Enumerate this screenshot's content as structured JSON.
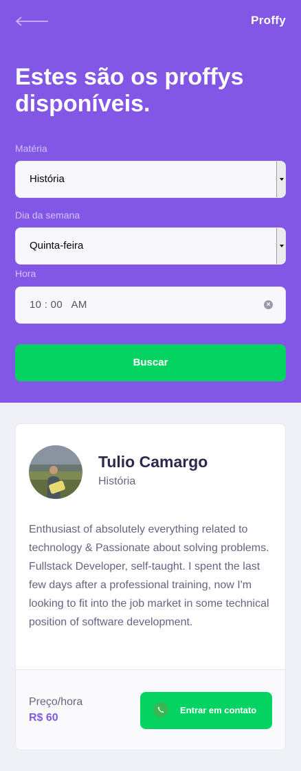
{
  "header": {
    "logo": "Proffy",
    "title": "Estes são os proffys disponíveis."
  },
  "filters": {
    "subject_label": "Matéria",
    "subject_value": "História",
    "weekday_label": "Dia da semana",
    "weekday_value": "Quinta-feira",
    "time_label": "Hora",
    "time_value": "10 : 00   AM",
    "search_label": "Buscar"
  },
  "teacher": {
    "name": "Tulio Camargo",
    "subject": "História",
    "bio": "Enthusiast of absolutely everything related to technology & Passionate about solving problems. Fullstack Developer, self-taught. I spent the last few days after a professional training, now I'm looking to fit into the job market in some technical position of software development.",
    "price_label": "Preço/hora",
    "price_value": "R$ 60",
    "contact_label": "Entrar em contato"
  },
  "colors": {
    "primary": "#8257e5",
    "success": "#04d361",
    "background": "#f0f0f7"
  },
  "icons": {
    "back": "arrow-left-icon",
    "contact": "whatsapp-icon",
    "clear": "clear-icon"
  }
}
